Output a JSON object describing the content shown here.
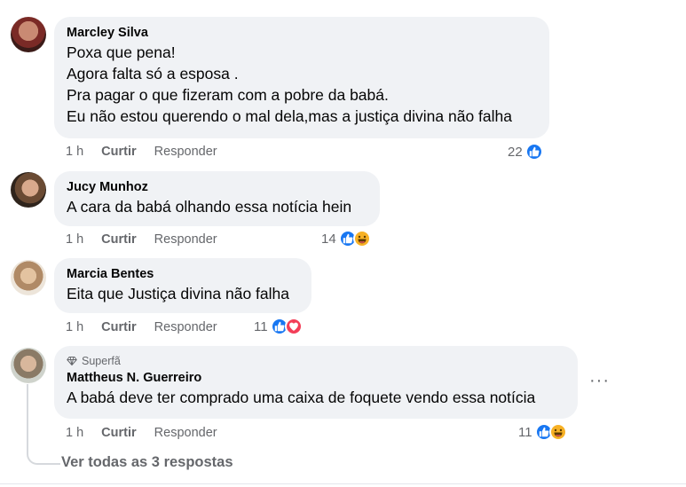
{
  "comments": [
    {
      "author": "Marcley Silva",
      "text": "Poxa que pena!\nAgora falta só a esposa .\nPra pagar o que fizeram com a pobre da babá.\nEu não estou querendo o mal dela,mas a justiça divina não falha",
      "time": "1 h",
      "like_label": "Curtir",
      "reply_label": "Responder",
      "reaction_count": "22",
      "reactions": [
        "like-icon"
      ]
    },
    {
      "author": "Jucy Munhoz",
      "text": "A cara da babá olhando essa notícia hein",
      "time": "1 h",
      "like_label": "Curtir",
      "reply_label": "Responder",
      "reaction_count": "14",
      "reactions": [
        "like-icon",
        "haha-icon"
      ]
    },
    {
      "author": "Marcia Bentes",
      "text": "Eita que Justiça divina não falha",
      "time": "1 h",
      "like_label": "Curtir",
      "reply_label": "Responder",
      "reaction_count": "11",
      "reactions": [
        "like-icon",
        "love-icon"
      ]
    },
    {
      "badge": "Superfã",
      "author": "Mattheus N. Guerreiro",
      "text": "A babá deve ter comprado uma caixa de foquete vendo essa notícia",
      "time": "1 h",
      "like_label": "Curtir",
      "reply_label": "Responder",
      "reaction_count": "11",
      "reactions": [
        "like-icon",
        "haha-icon"
      ]
    }
  ],
  "more_options": "···",
  "view_all_replies": "Ver todas as 3 respostas",
  "colors": {
    "bubble": "#f0f2f5",
    "secondary_text": "#65676b",
    "like_blue": "#1877f2",
    "love_red": "#f33e58",
    "haha_yellow": "#f7b125"
  }
}
